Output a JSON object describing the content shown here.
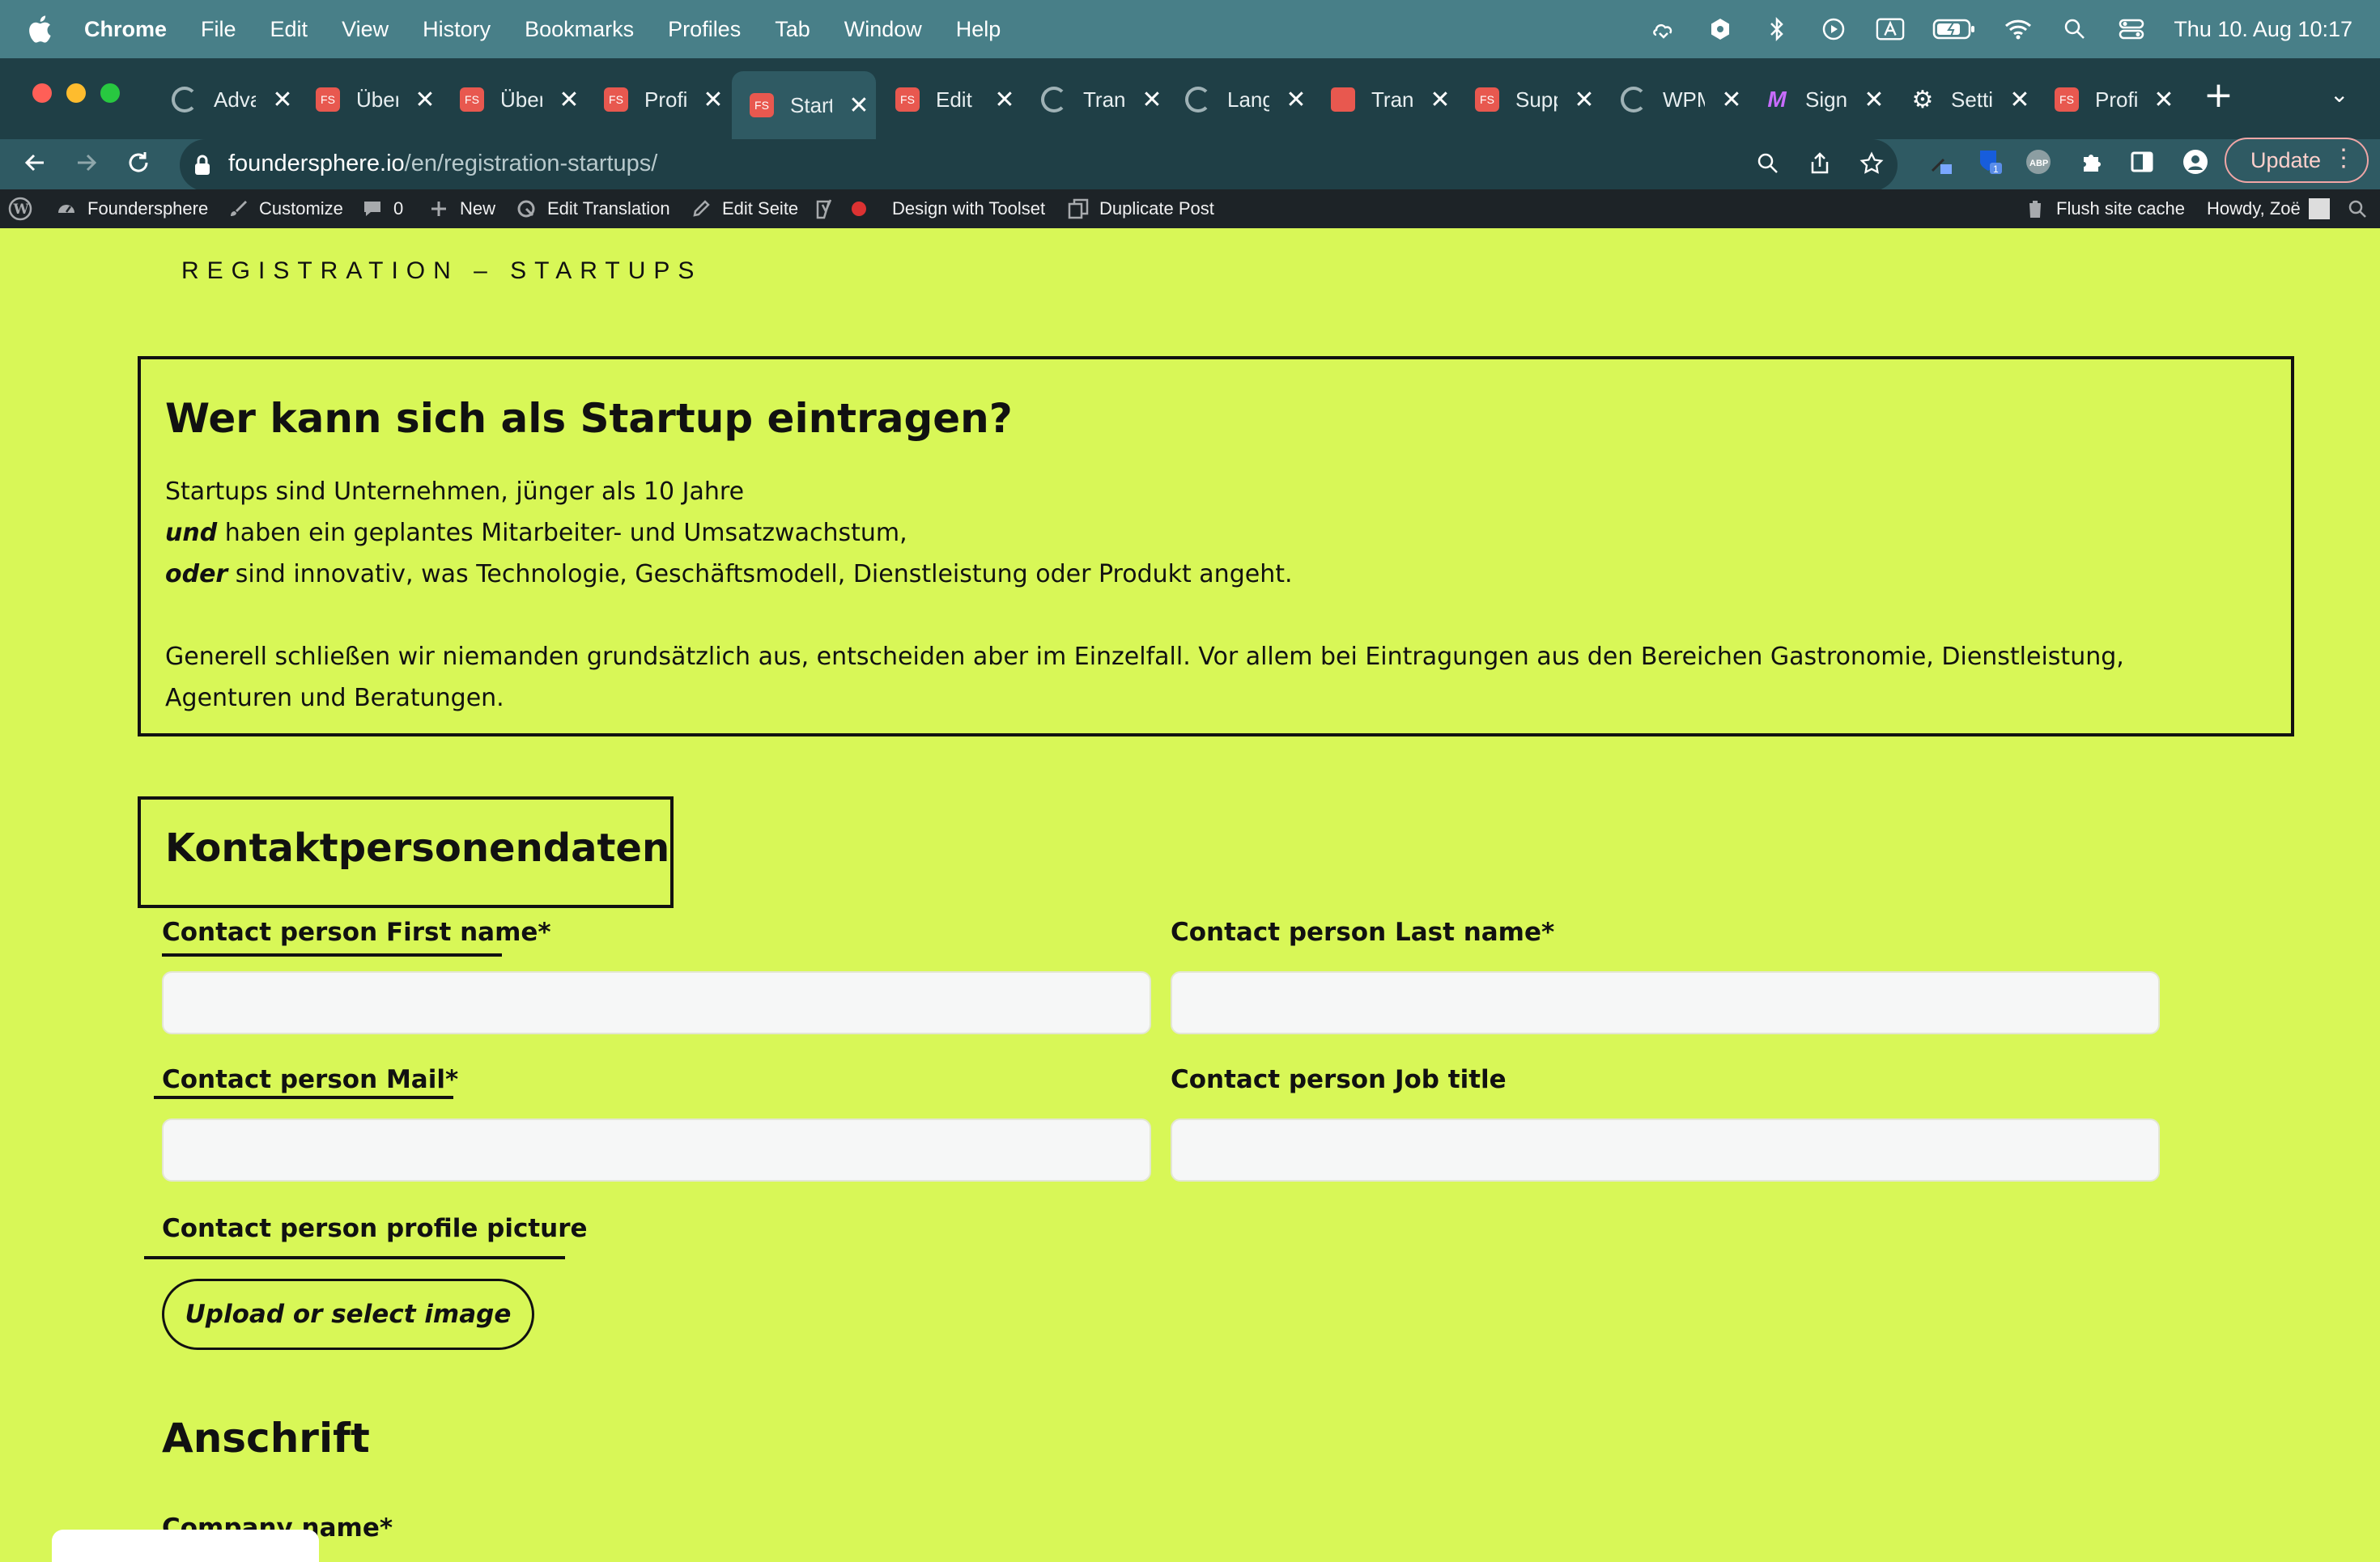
{
  "menubar": {
    "app": "Chrome",
    "items": [
      "File",
      "Edit",
      "View",
      "History",
      "Bookmarks",
      "Profiles",
      "Tab",
      "Window",
      "Help"
    ],
    "clock": "Thu 10. Aug  10:17"
  },
  "tabs": [
    {
      "label": "Adva",
      "favicon": "loading-icon"
    },
    {
      "label": "Über",
      "favicon": "foundersphere-icon"
    },
    {
      "label": "Über",
      "favicon": "foundersphere-icon"
    },
    {
      "label": "Profi",
      "favicon": "foundersphere-icon"
    },
    {
      "label": "Start",
      "favicon": "foundersphere-icon",
      "active": true
    },
    {
      "label": "Edit",
      "favicon": "foundersphere-icon"
    },
    {
      "label": "Tran",
      "favicon": "loading-icon"
    },
    {
      "label": "Lang",
      "favicon": "loading-icon"
    },
    {
      "label": "Tran",
      "favicon": "briefcase-icon"
    },
    {
      "label": "Supp",
      "favicon": "foundersphere-icon"
    },
    {
      "label": "WPM",
      "favicon": "loading-icon"
    },
    {
      "label": "Sign",
      "favicon": "m-logo-icon"
    },
    {
      "label": "Setti",
      "favicon": "gear-icon"
    },
    {
      "label": "Profi",
      "favicon": "foundersphere-icon"
    }
  ],
  "toolbar": {
    "url_host": "foundersphere.io",
    "url_path": "/en/registration-startups/",
    "update_label": "Update"
  },
  "wpbar": {
    "site": "Foundersphere",
    "customize": "Customize",
    "comments": "0",
    "new": "New",
    "edit_translation": "Edit Translation",
    "edit_page": "Edit Seite",
    "toolset": "Design with Toolset",
    "duplicate": "Duplicate Post",
    "flush": "Flush site cache",
    "howdy": "Howdy, Zoë"
  },
  "page": {
    "title": "REGISTRATION – STARTUPS",
    "info": {
      "heading": "Wer kann sich als Startup eintragen?",
      "line1": "Startups sind Unternehmen, jünger als 10 Jahre",
      "line2_em": "und",
      "line2_rest": " haben ein geplantes Mitarbeiter- und Umsatzwachstum,",
      "line3_em": "oder",
      "line3_rest": " sind innovativ, was Technologie, Geschäftsmodell, Dienstleistung oder Produkt angeht.",
      "line4": "Generell schließen wir niemanden grundsätzlich aus, entscheiden aber im Einzelfall. Vor allem bei Eintragungen aus den Bereichen Gastronomie, Dienstleistung,",
      "line5": "Agenturen und Beratungen."
    },
    "section_heading": "Kontaktpersonendaten",
    "fields": {
      "first_name": "Contact person First name*",
      "last_name": "Contact person Last name*",
      "mail": "Contact person Mail*",
      "job_title": "Contact person Job title",
      "picture": "Contact person profile picture"
    },
    "upload_label": "Upload or select image",
    "address_heading": "Anschrift",
    "company_label": "Company name*"
  }
}
